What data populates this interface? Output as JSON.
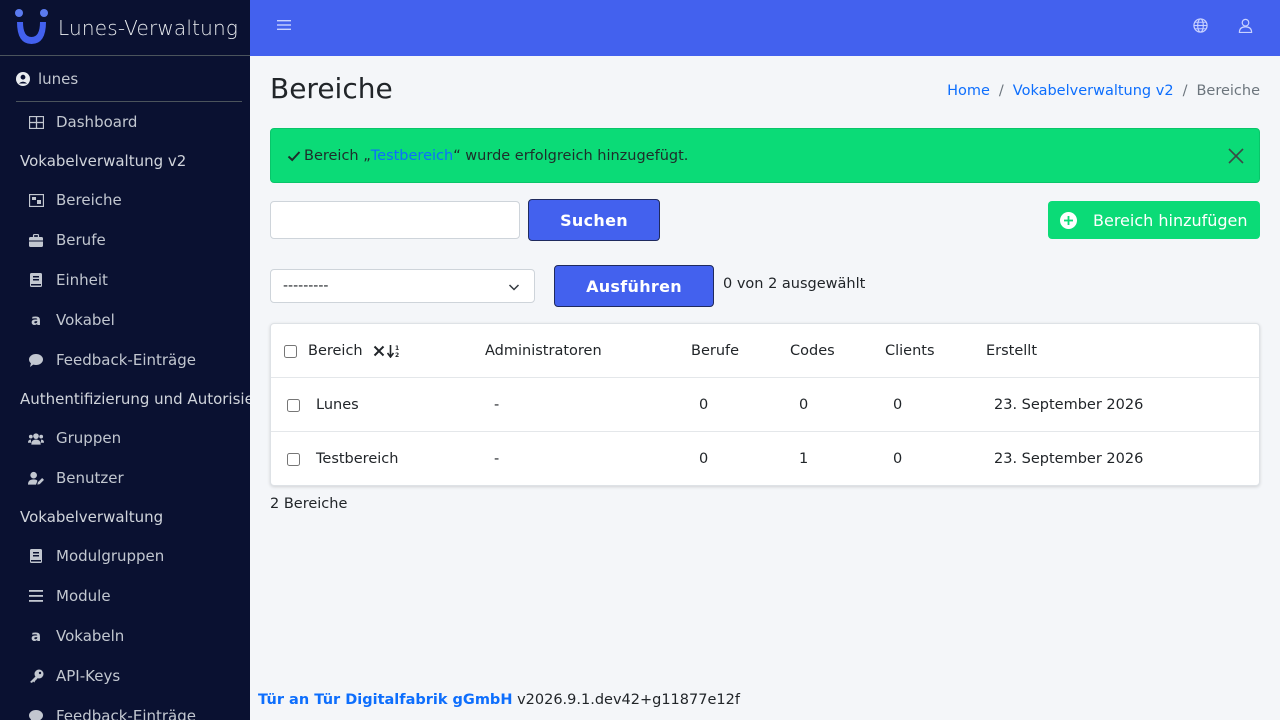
{
  "brand": {
    "name": "Lunes-Verwaltung"
  },
  "user": {
    "name": "lunes"
  },
  "sidebar": {
    "items": [
      {
        "type": "item",
        "label": "Dashboard",
        "icon": "dashboard-icon"
      },
      {
        "type": "header",
        "label": "Vokabelverwaltung v2"
      },
      {
        "type": "item",
        "label": "Bereiche",
        "icon": "area-icon"
      },
      {
        "type": "item",
        "label": "Berufe",
        "icon": "briefcase-icon"
      },
      {
        "type": "item",
        "label": "Einheit",
        "icon": "book-icon"
      },
      {
        "type": "item",
        "label": "Vokabel",
        "icon": "letter-a-icon"
      },
      {
        "type": "item",
        "label": "Feedback-Einträge",
        "icon": "comment-icon"
      },
      {
        "type": "header",
        "label": "Authentifizierung und Autorisierung"
      },
      {
        "type": "item",
        "label": "Gruppen",
        "icon": "users-icon"
      },
      {
        "type": "item",
        "label": "Benutzer",
        "icon": "user-edit-icon"
      },
      {
        "type": "header",
        "label": "Vokabelverwaltung"
      },
      {
        "type": "item",
        "label": "Modulgruppen",
        "icon": "book-icon"
      },
      {
        "type": "item",
        "label": "Module",
        "icon": "list-icon"
      },
      {
        "type": "item",
        "label": "Vokabeln",
        "icon": "letter-a-icon"
      },
      {
        "type": "item",
        "label": "API-Keys",
        "icon": "key-icon"
      },
      {
        "type": "item",
        "label": "Feedback-Einträge",
        "icon": "comment-icon"
      }
    ]
  },
  "page": {
    "title": "Bereiche",
    "breadcrumb": [
      "Home",
      "Vokabelverwaltung v2",
      "Bereiche"
    ]
  },
  "alert": {
    "prefix": "Bereich „",
    "link": "Testbereich",
    "suffix": "“ wurde erfolgreich hinzugefügt."
  },
  "search": {
    "value": "",
    "button": "Suchen"
  },
  "add_button": "Bereich hinzufügen",
  "actions": {
    "selected": "---------",
    "run_button": "Ausführen",
    "selection_count": "0 von 2 ausgewählt"
  },
  "table": {
    "columns": [
      "Bereich",
      "Administratoren",
      "Berufe",
      "Codes",
      "Clients",
      "Erstellt"
    ],
    "rows": [
      {
        "bereich": "Lunes",
        "administratoren": "-",
        "berufe": "0",
        "codes": "0",
        "clients": "0",
        "erstellt": "23. September 2026"
      },
      {
        "bereich": "Testbereich",
        "administratoren": "-",
        "berufe": "0",
        "codes": "1",
        "clients": "0",
        "erstellt": "23. September 2026"
      }
    ]
  },
  "result_count": "2 Bereiche",
  "footer": {
    "company": "Tür an Tür Digitalfabrik gGmbH",
    "version": "v2026.9.1.dev42+g11877e12f"
  },
  "colors": {
    "sidebar_bg": "#0a1131",
    "topbar": "#4361ee",
    "success": "#0bdb77",
    "link": "#0d6efd"
  }
}
